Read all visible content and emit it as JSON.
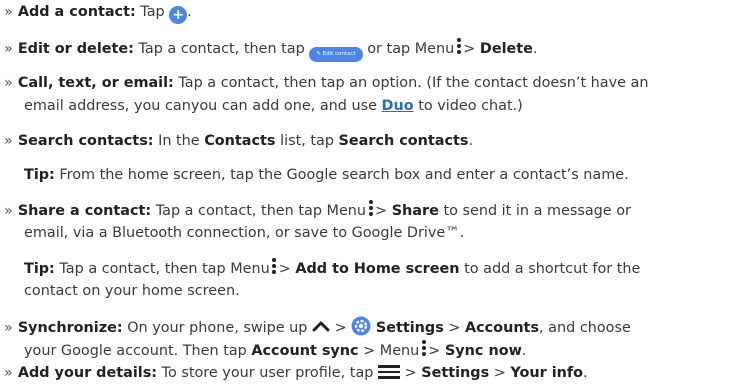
{
  "bullet": "»",
  "add": {
    "label": "Add a contact:",
    "text": "Tap",
    "period": ".",
    "plus": "+"
  },
  "edit": {
    "label": "Edit or delete:",
    "text1": "Tap a contact, then tap",
    "pill": "Edit contact",
    "text2": "or tap Menu",
    "gt": ">",
    "delete": "Delete",
    "period": "."
  },
  "call": {
    "label": "Call, text, or email:",
    "line1": "Tap a contact, then tap an option. (If the contact doesn’t have an",
    "line2a": "email address, you canyou can add one, and use",
    "duo": "Duo",
    "line2b": "to video chat.)"
  },
  "search": {
    "label": "Search contacts:",
    "text1": "In the",
    "contacts": "Contacts",
    "text2": "list, tap",
    "action": "Search contacts",
    "period": "."
  },
  "tip1": {
    "label": "Tip:",
    "text": "From the home screen, tap the Google search box and enter a contact’s name."
  },
  "share": {
    "label": "Share a contact:",
    "text1": "Tap a contact, then tap Menu",
    "gt": ">",
    "share": "Share",
    "text2": "to send it in a message or",
    "line2": "email, via a Bluetooth connection, or save to Google Drive™."
  },
  "tip2": {
    "label": "Tip:",
    "text1": "Tap a contact, then tap Menu",
    "gt": ">",
    "action": "Add to Home screen",
    "text2": "to add a shortcut for the",
    "line2": "contact on your home screen."
  },
  "sync": {
    "label": "Synchronize:",
    "text1": "On your phone, swipe up",
    "gt": ">",
    "settings": "Settings",
    "accounts": "Accounts",
    "text2": ", and choose",
    "line2a": "your Google account. Then tap",
    "accountsync": "Account sync",
    "menu": "> Menu",
    "syncnow": "Sync now",
    "period": "."
  },
  "details": {
    "label": "Add your details:",
    "text1": "To store your user profile, tap",
    "gt": ">",
    "settings": "Settings",
    "yourinfo": "Your info",
    "period": "."
  },
  "colors": {
    "accent": "#4a86e8",
    "link": "#2a6fb5",
    "text": "#3a3a3a"
  }
}
